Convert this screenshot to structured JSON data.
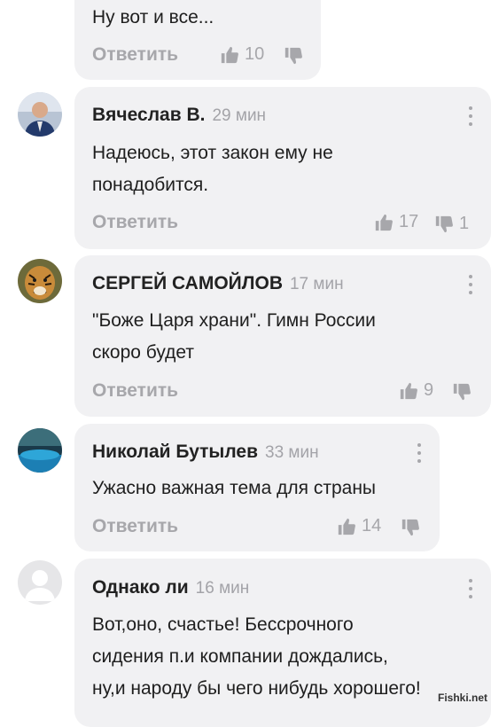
{
  "comments": [
    {
      "text_lines": [
        "Ну вот и все..."
      ],
      "reply_label": "Ответить",
      "likes": "10",
      "dislikes": ""
    },
    {
      "author": "Вячеслав В.",
      "time": "29 мин",
      "text_lines": [
        "Надеюсь, этот закон ему не",
        "понадобится."
      ],
      "reply_label": "Ответить",
      "likes": "17",
      "dislikes": "1"
    },
    {
      "author": "СЕРГЕЙ САМОЙЛОВ",
      "time": "17 мин",
      "text_lines": [
        "\"Боже Царя храни\". Гимн России",
        "скоро будет"
      ],
      "reply_label": "Ответить",
      "likes": "9",
      "dislikes": ""
    },
    {
      "author": "Николай Бутылев",
      "time": "33 мин",
      "text_lines": [
        "Ужасно важная тема для страны"
      ],
      "reply_label": "Ответить",
      "likes": "14",
      "dislikes": ""
    },
    {
      "author": "Однако ли",
      "time": "16 мин",
      "text_lines": [
        "Вот,оно, счастье! Бессрочного",
        "сидения  п.и  компании дождались,",
        "ну,и народу бы чего нибудь хорошего!"
      ]
    }
  ],
  "watermark": "Fishki.net",
  "colors": {
    "bubble": "#f1f1f3",
    "muted": "#a7a7ab"
  }
}
